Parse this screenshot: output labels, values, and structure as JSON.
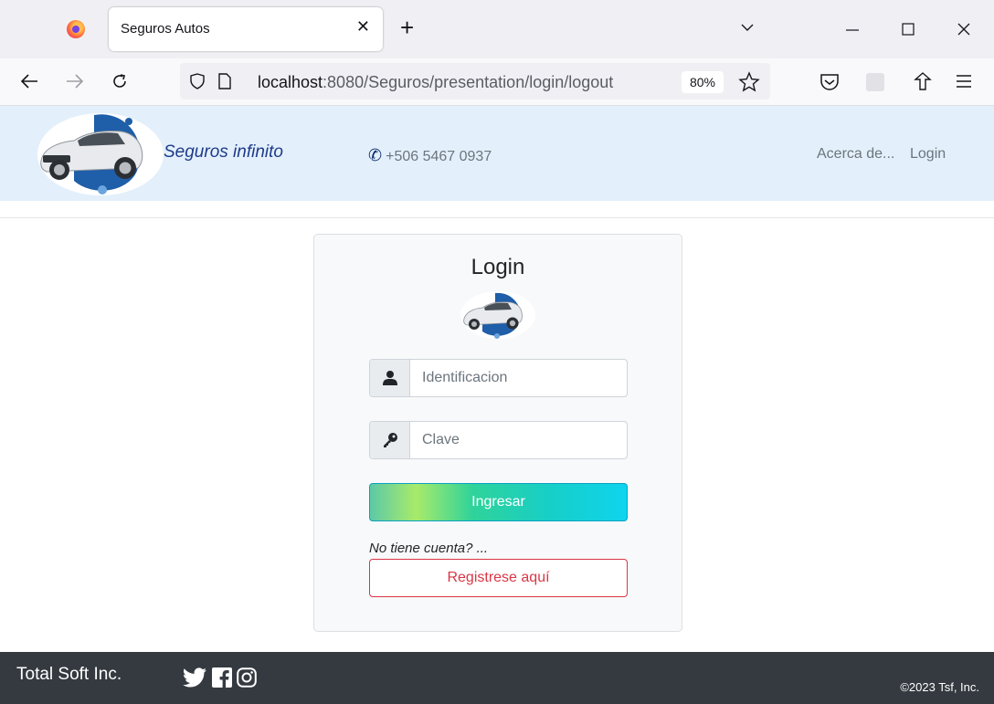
{
  "browser": {
    "tab_title": "Seguros Autos",
    "tab_close": "✕",
    "new_tab": "+",
    "url_host": "localhost",
    "url_path": ":8080/Seguros/presentation/login/logout",
    "zoom": "80%"
  },
  "header": {
    "brand": "Seguros infinito",
    "phone": "+506 5467 0937",
    "nav": [
      "Acerca de...",
      "Login"
    ]
  },
  "login": {
    "title": "Login",
    "id_placeholder": "Identificacion",
    "password_placeholder": "Clave",
    "submit_label": "Ingresar",
    "no_account": "No tiene cuenta? ...",
    "register_label": "Registrese aquí"
  },
  "footer": {
    "brand": "Total Soft Inc.",
    "copyright": "©2023 Tsf, Inc."
  },
  "icons": [
    "firefox-logo-icon",
    "back-icon",
    "forward-icon",
    "reload-icon",
    "shield-icon",
    "page-icon",
    "star-icon",
    "pocket-icon",
    "extension-icon",
    "share-icon",
    "menu-icon",
    "phone-icon",
    "user-icon",
    "key-icon",
    "twitter-icon",
    "facebook-icon",
    "instagram-icon"
  ],
  "colors": {
    "header_bg": "#e3f0fb",
    "brand_text": "#1e3a8a",
    "register_red": "#dc3545",
    "footer_bg": "#343a40"
  }
}
